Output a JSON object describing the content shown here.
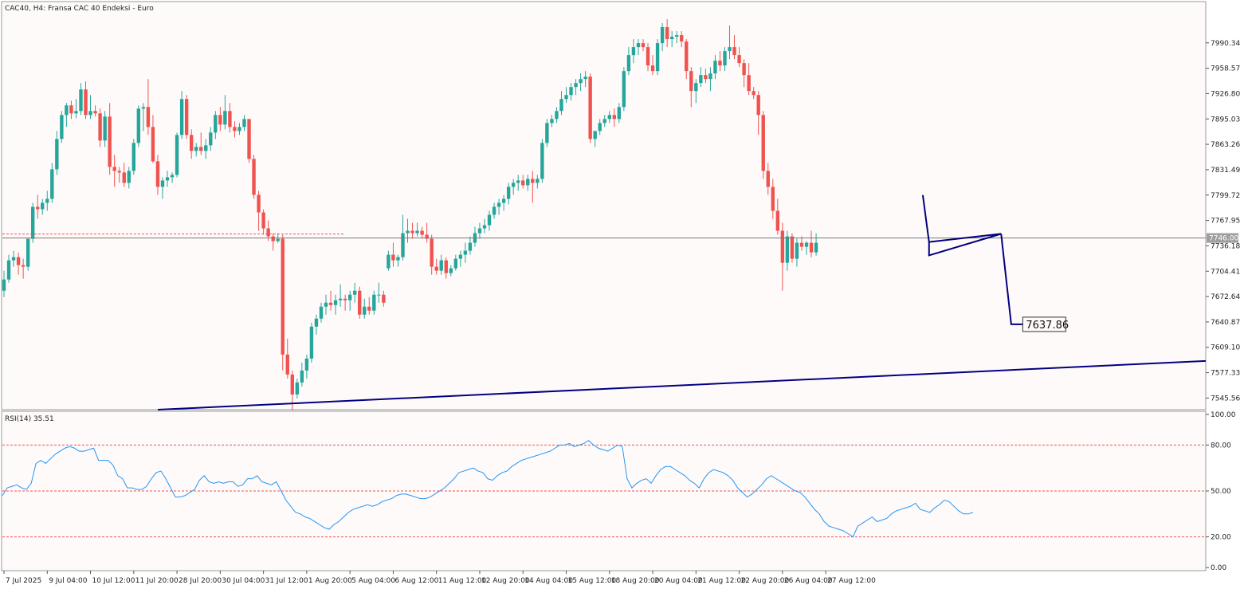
{
  "header": {
    "title": "CAC40, H4:  Fransa CAC 40 Endeksi - Euro"
  },
  "rsi": {
    "label": "RSI(14) 35.51"
  },
  "colors": {
    "bull": "#26a69a",
    "bear": "#ef5350",
    "rsi_line": "#2196f3",
    "trendline": "#000080",
    "level_line": "#ef5350"
  },
  "chart_data": [
    {
      "type": "candlestick",
      "title": "CAC40, H4:  Fransa CAC 40 Endeksi - Euro",
      "y_ticks": [
        "7990.34",
        "7958.57",
        "7926.80",
        "7895.03",
        "7863.26",
        "7831.49",
        "7799.72",
        "7767.95",
        "7736.18",
        "7704.41",
        "7672.64",
        "7640.87",
        "7609.10",
        "7577.33",
        "7545.56"
      ],
      "ylim": [
        7531,
        8042
      ],
      "current_price": "7746.00",
      "target_label": "7637.86",
      "x_ticks": [
        "7 Jul 2025",
        "9 Jul 04:00",
        "10 Jul 12:00",
        "11 Jul 20:00",
        "28 Jul 20:00",
        "30 Jul 04:00",
        "31 Jul 12:00",
        "1 Aug 20:00",
        "5 Aug 04:00",
        "6 Aug 12:00",
        "11 Aug 12:00",
        "12 Aug 20:00",
        "14 Aug 04:00",
        "15 Aug 12:00",
        "18 Aug 20:00",
        "20 Aug 04:00",
        "21 Aug 12:00",
        "22 Aug 20:00",
        "26 Aug 04:00",
        "27 Aug 12:00"
      ],
      "candles": [
        [
          7680,
          7705,
          7672,
          7694
        ],
        [
          7694,
          7725,
          7690,
          7718
        ],
        [
          7718,
          7730,
          7710,
          7722
        ],
        [
          7722,
          7728,
          7700,
          7712
        ],
        [
          7712,
          7720,
          7695,
          7710
        ],
        [
          7710,
          7745,
          7705,
          7745
        ],
        [
          7745,
          7790,
          7740,
          7785
        ],
        [
          7785,
          7800,
          7770,
          7782
        ],
        [
          7782,
          7795,
          7775,
          7790
        ],
        [
          7790,
          7805,
          7780,
          7795
        ],
        [
          7795,
          7840,
          7790,
          7832
        ],
        [
          7832,
          7880,
          7825,
          7870
        ],
        [
          7870,
          7905,
          7865,
          7900
        ],
        [
          7900,
          7915,
          7885,
          7912
        ],
        [
          7912,
          7918,
          7895,
          7902
        ],
        [
          7902,
          7920,
          7896,
          7905
        ],
        [
          7905,
          7940,
          7900,
          7932
        ],
        [
          7932,
          7942,
          7895,
          7900
        ],
        [
          7900,
          7925,
          7895,
          7905
        ],
        [
          7905,
          7912,
          7898,
          7902
        ],
        [
          7902,
          7908,
          7860,
          7868
        ],
        [
          7868,
          7905,
          7860,
          7898
        ],
        [
          7898,
          7915,
          7825,
          7835
        ],
        [
          7835,
          7850,
          7810,
          7830
        ],
        [
          7830,
          7835,
          7815,
          7828
        ],
        [
          7828,
          7840,
          7810,
          7815
        ],
        [
          7815,
          7835,
          7808,
          7830
        ],
        [
          7830,
          7870,
          7825,
          7865
        ],
        [
          7865,
          7912,
          7860,
          7908
        ],
        [
          7908,
          7915,
          7880,
          7910
        ],
        [
          7910,
          7945,
          7875,
          7885
        ],
        [
          7885,
          7900,
          7840,
          7842
        ],
        [
          7842,
          7850,
          7800,
          7810
        ],
        [
          7810,
          7822,
          7795,
          7818
        ],
        [
          7818,
          7830,
          7810,
          7822
        ],
        [
          7822,
          7828,
          7815,
          7825
        ],
        [
          7825,
          7878,
          7822,
          7875
        ],
        [
          7875,
          7930,
          7870,
          7920
        ],
        [
          7920,
          7925,
          7870,
          7875
        ],
        [
          7875,
          7882,
          7845,
          7855
        ],
        [
          7855,
          7865,
          7848,
          7860
        ],
        [
          7860,
          7878,
          7850,
          7855
        ],
        [
          7855,
          7870,
          7845,
          7862
        ],
        [
          7862,
          7885,
          7855,
          7878
        ],
        [
          7878,
          7905,
          7870,
          7900
        ],
        [
          7900,
          7910,
          7880,
          7888
        ],
        [
          7888,
          7925,
          7882,
          7905
        ],
        [
          7905,
          7915,
          7878,
          7885
        ],
        [
          7885,
          7892,
          7872,
          7880
        ],
        [
          7880,
          7890,
          7875,
          7885
        ],
        [
          7885,
          7900,
          7880,
          7895
        ],
        [
          7895,
          7895,
          7840,
          7845
        ],
        [
          7845,
          7850,
          7795,
          7800
        ],
        [
          7800,
          7805,
          7755,
          7778
        ],
        [
          7778,
          7782,
          7750,
          7758
        ],
        [
          7758,
          7768,
          7742,
          7748
        ],
        [
          7748,
          7752,
          7730,
          7742
        ],
        [
          7742,
          7752,
          7740,
          7745
        ],
        [
          7745,
          7750,
          7580,
          7600
        ],
        [
          7600,
          7620,
          7570,
          7575
        ],
        [
          7575,
          7580,
          7530,
          7550
        ],
        [
          7550,
          7570,
          7545,
          7565
        ],
        [
          7565,
          7590,
          7560,
          7580
        ],
        [
          7580,
          7600,
          7570,
          7595
        ],
        [
          7595,
          7640,
          7590,
          7635
        ],
        [
          7635,
          7650,
          7625,
          7645
        ],
        [
          7645,
          7665,
          7640,
          7660
        ],
        [
          7660,
          7675,
          7650,
          7665
        ],
        [
          7665,
          7680,
          7655,
          7662
        ],
        [
          7662,
          7675,
          7650,
          7668
        ],
        [
          7668,
          7688,
          7660,
          7670
        ],
        [
          7670,
          7675,
          7655,
          7668
        ],
        [
          7668,
          7680,
          7655,
          7675
        ],
        [
          7675,
          7690,
          7665,
          7680
        ],
        [
          7680,
          7685,
          7645,
          7650
        ],
        [
          7650,
          7670,
          7645,
          7660
        ],
        [
          7660,
          7672,
          7650,
          7655
        ],
        [
          7655,
          7680,
          7650,
          7675
        ],
        [
          7675,
          7690,
          7665,
          7675
        ],
        [
          7675,
          7680,
          7660,
          7665
        ],
        [
          7708,
          7730,
          7705,
          7725
        ],
        [
          7725,
          7740,
          7710,
          7718
        ],
        [
          7718,
          7725,
          7710,
          7722
        ],
        [
          7722,
          7775,
          7718,
          7752
        ],
        [
          7752,
          7770,
          7740,
          7755
        ],
        [
          7755,
          7765,
          7745,
          7752
        ],
        [
          7752,
          7765,
          7748,
          7755
        ],
        [
          7755,
          7760,
          7745,
          7750
        ],
        [
          7750,
          7765,
          7740,
          7745
        ],
        [
          7745,
          7750,
          7700,
          7710
        ],
        [
          7710,
          7720,
          7700,
          7705
        ],
        [
          7705,
          7725,
          7700,
          7718
        ],
        [
          7718,
          7722,
          7695,
          7702
        ],
        [
          7702,
          7712,
          7698,
          7708
        ],
        [
          7708,
          7725,
          7705,
          7720
        ],
        [
          7720,
          7730,
          7710,
          7725
        ],
        [
          7725,
          7740,
          7715,
          7730
        ],
        [
          7730,
          7748,
          7725,
          7740
        ],
        [
          7740,
          7760,
          7735,
          7752
        ],
        [
          7752,
          7765,
          7745,
          7758
        ],
        [
          7758,
          7770,
          7752,
          7762
        ],
        [
          7762,
          7780,
          7755,
          7775
        ],
        [
          7775,
          7790,
          7770,
          7785
        ],
        [
          7785,
          7795,
          7775,
          7790
        ],
        [
          7790,
          7800,
          7780,
          7795
        ],
        [
          7795,
          7815,
          7788,
          7810
        ],
        [
          7810,
          7820,
          7800,
          7815
        ],
        [
          7815,
          7825,
          7805,
          7818
        ],
        [
          7818,
          7825,
          7808,
          7812
        ],
        [
          7812,
          7825,
          7805,
          7820
        ],
        [
          7820,
          7830,
          7790,
          7815
        ],
        [
          7815,
          7825,
          7808,
          7820
        ],
        [
          7820,
          7870,
          7815,
          7865
        ],
        [
          7865,
          7895,
          7860,
          7890
        ],
        [
          7890,
          7900,
          7885,
          7895
        ],
        [
          7895,
          7910,
          7890,
          7905
        ],
        [
          7905,
          7930,
          7900,
          7920
        ],
        [
          7920,
          7935,
          7915,
          7925
        ],
        [
          7925,
          7940,
          7918,
          7935
        ],
        [
          7935,
          7945,
          7925,
          7940
        ],
        [
          7940,
          7952,
          7930,
          7945
        ],
        [
          7945,
          7955,
          7935,
          7948
        ],
        [
          7948,
          7952,
          7865,
          7870
        ],
        [
          7870,
          7880,
          7860,
          7880
        ],
        [
          7880,
          7895,
          7875,
          7890
        ],
        [
          7890,
          7900,
          7885,
          7895
        ],
        [
          7895,
          7905,
          7890,
          7900
        ],
        [
          7900,
          7908,
          7885,
          7895
        ],
        [
          7895,
          7915,
          7890,
          7910
        ],
        [
          7910,
          7960,
          7905,
          7955
        ],
        [
          7955,
          7985,
          7950,
          7975
        ],
        [
          7975,
          7995,
          7965,
          7985
        ],
        [
          7985,
          7995,
          7975,
          7990
        ],
        [
          7990,
          7995,
          7980,
          7985
        ],
        [
          7985,
          7990,
          7955,
          7962
        ],
        [
          7962,
          7975,
          7950,
          7955
        ],
        [
          7955,
          7995,
          7950,
          7990
        ],
        [
          7990,
          8015,
          7980,
          8010
        ],
        [
          8010,
          8020,
          7985,
          7995
        ],
        [
          7995,
          8005,
          7985,
          7998
        ],
        [
          7998,
          8005,
          7990,
          8000
        ],
        [
          8000,
          8005,
          7985,
          7992
        ],
        [
          7992,
          7995,
          7945,
          7955
        ],
        [
          7955,
          7960,
          7910,
          7930
        ],
        [
          7930,
          7945,
          7915,
          7940
        ],
        [
          7940,
          7960,
          7935,
          7950
        ],
        [
          7950,
          7958,
          7940,
          7945
        ],
        [
          7945,
          7960,
          7930,
          7952
        ],
        [
          7952,
          7975,
          7945,
          7968
        ],
        [
          7968,
          7980,
          7955,
          7962
        ],
        [
          7962,
          7985,
          7955,
          7980
        ],
        [
          7980,
          8012,
          7970,
          7985
        ],
        [
          7985,
          8000,
          7970,
          7975
        ],
        [
          7975,
          7985,
          7960,
          7965
        ],
        [
          7965,
          7970,
          7935,
          7950
        ],
        [
          7950,
          7965,
          7925,
          7930
        ],
        [
          7930,
          7935,
          7920,
          7925
        ],
        [
          7925,
          7930,
          7875,
          7900
        ],
        [
          7900,
          7905,
          7820,
          7830
        ],
        [
          7830,
          7840,
          7800,
          7810
        ],
        [
          7810,
          7820,
          7770,
          7780
        ],
        [
          7780,
          7795,
          7750,
          7755
        ],
        [
          7755,
          7765,
          7680,
          7715
        ],
        [
          7715,
          7755,
          7705,
          7748
        ],
        [
          7748,
          7752,
          7715,
          7720
        ],
        [
          7720,
          7745,
          7710,
          7740
        ],
        [
          7740,
          7748,
          7730,
          7735
        ],
        [
          7735,
          7742,
          7725,
          7740
        ],
        [
          7740,
          7755,
          7722,
          7728
        ],
        [
          7728,
          7752,
          7724,
          7740
        ]
      ],
      "target_path": [
        7799.7,
        7741.0,
        7751.2,
        7724.2,
        7637.86
      ],
      "support_line": [
        7531,
        7592
      ]
    },
    {
      "type": "line",
      "title": "RSI(14) 35.51",
      "y_ticks": [
        "100.00",
        "80.00",
        "50.00",
        "20.00",
        "0.00"
      ],
      "ylim": [
        0,
        100
      ],
      "levels": [
        80,
        50,
        20
      ],
      "values": [
        47,
        52,
        53,
        54,
        52,
        51,
        55,
        68,
        70,
        68,
        71,
        74,
        76,
        78,
        79,
        78,
        76,
        76,
        77,
        78,
        70,
        70,
        70,
        67,
        60,
        58,
        52,
        52,
        51,
        51,
        53,
        58,
        62,
        63,
        58,
        52,
        46,
        46,
        47,
        49,
        51,
        57,
        60,
        56,
        55,
        56,
        55,
        56,
        56,
        53,
        54,
        58,
        58,
        60,
        56,
        55,
        54,
        56,
        50,
        44,
        40,
        36,
        35,
        33,
        32,
        30,
        28,
        26,
        25,
        28,
        30,
        33,
        36,
        38,
        39,
        40,
        41,
        40,
        41,
        43,
        44,
        45,
        47,
        48,
        48,
        47,
        46,
        45,
        45,
        46,
        48,
        50,
        52,
        55,
        58,
        62,
        63,
        64,
        65,
        63,
        62,
        58,
        57,
        60,
        62,
        63,
        66,
        68,
        70,
        71,
        72,
        73,
        74,
        75,
        76,
        78,
        80,
        80,
        81,
        79,
        80,
        81,
        83,
        80,
        78,
        77,
        76,
        78,
        80,
        79,
        58,
        52,
        55,
        57,
        58,
        55,
        60,
        64,
        66,
        66,
        64,
        62,
        60,
        57,
        55,
        52,
        58,
        62,
        64,
        63,
        62,
        60,
        57,
        52,
        49,
        46,
        48,
        51,
        54,
        58,
        60,
        58,
        56,
        54,
        52,
        50,
        49,
        46,
        42,
        38,
        35,
        30,
        27,
        26,
        25,
        24,
        22,
        20,
        27,
        29,
        31,
        33,
        30,
        31,
        32,
        35,
        37,
        38,
        39,
        40,
        42,
        38,
        37,
        36,
        39,
        41,
        44,
        43,
        40,
        37,
        35,
        35,
        36
      ]
    }
  ]
}
